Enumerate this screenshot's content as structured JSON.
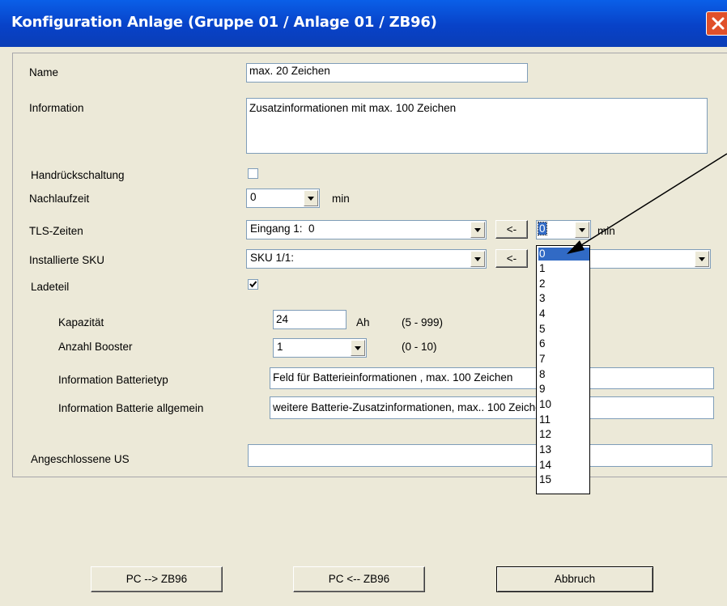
{
  "dialog": {
    "title": "Konfiguration Anlage (Gruppe 01 / Anlage 01 / ZB96)"
  },
  "form": {
    "name_label": "Name",
    "name_value": "max. 20 Zeichen",
    "information_label": "Information",
    "information_value": "Zusatzinformationen mit max. 100 Zeichen",
    "handrueck_label": "Handrückschaltung",
    "handrueck_checked": false,
    "nachlaufzeit_label": "Nachlaufzeit",
    "nachlaufzeit_value": "0",
    "nachlaufzeit_unit": "min",
    "tls_label": "TLS-Zeiten",
    "tls_value": "Eingang 1:  0",
    "tls_move_button": "<-",
    "tls_time_value": "0",
    "tls_time_unit": "min",
    "sku_label": "Installierte SKU",
    "sku_value": "SKU 1/1:",
    "sku_move_button": "<-",
    "ladeteil_label": "Ladeteil",
    "ladeteil_checked": true,
    "kapazitaet_label": "Kapazität",
    "kapazitaet_value": "24",
    "kapazitaet_unit": "Ah",
    "kapazitaet_range": "(5 - 999)",
    "booster_label": "Anzahl Booster",
    "booster_value": "1",
    "booster_range": "(0 - 10)",
    "batterietyp_label": "Information Batterietyp",
    "batterietyp_value": "Feld für Batterieinformationen , max. 100 Zeichen",
    "batterie_allg_label": "Information Batterie allgemein",
    "batterie_allg_value": "weitere Batterie-Zusatzinformationen, max.. 100 Zeichen",
    "us_label": "Angeschlossene US",
    "us_value": ""
  },
  "dropdown_list": {
    "options": [
      "0",
      "1",
      "2",
      "3",
      "4",
      "5",
      "6",
      "7",
      "8",
      "9",
      "10",
      "11",
      "12",
      "13",
      "14",
      "15"
    ],
    "selected": "0"
  },
  "buttons": {
    "pc_to_zb": "PC --> ZB96",
    "zb_to_pc": "PC <-- ZB96",
    "cancel": "Abbruch"
  },
  "icons": {
    "close": "close-icon",
    "dropdown": "chevron-down-icon",
    "checkbox_check": "check-icon"
  },
  "colors": {
    "titlebar": "#0842c8",
    "close_button": "#e0502a",
    "selection": "#316ac5",
    "dialog_bg": "#ece9d8"
  }
}
